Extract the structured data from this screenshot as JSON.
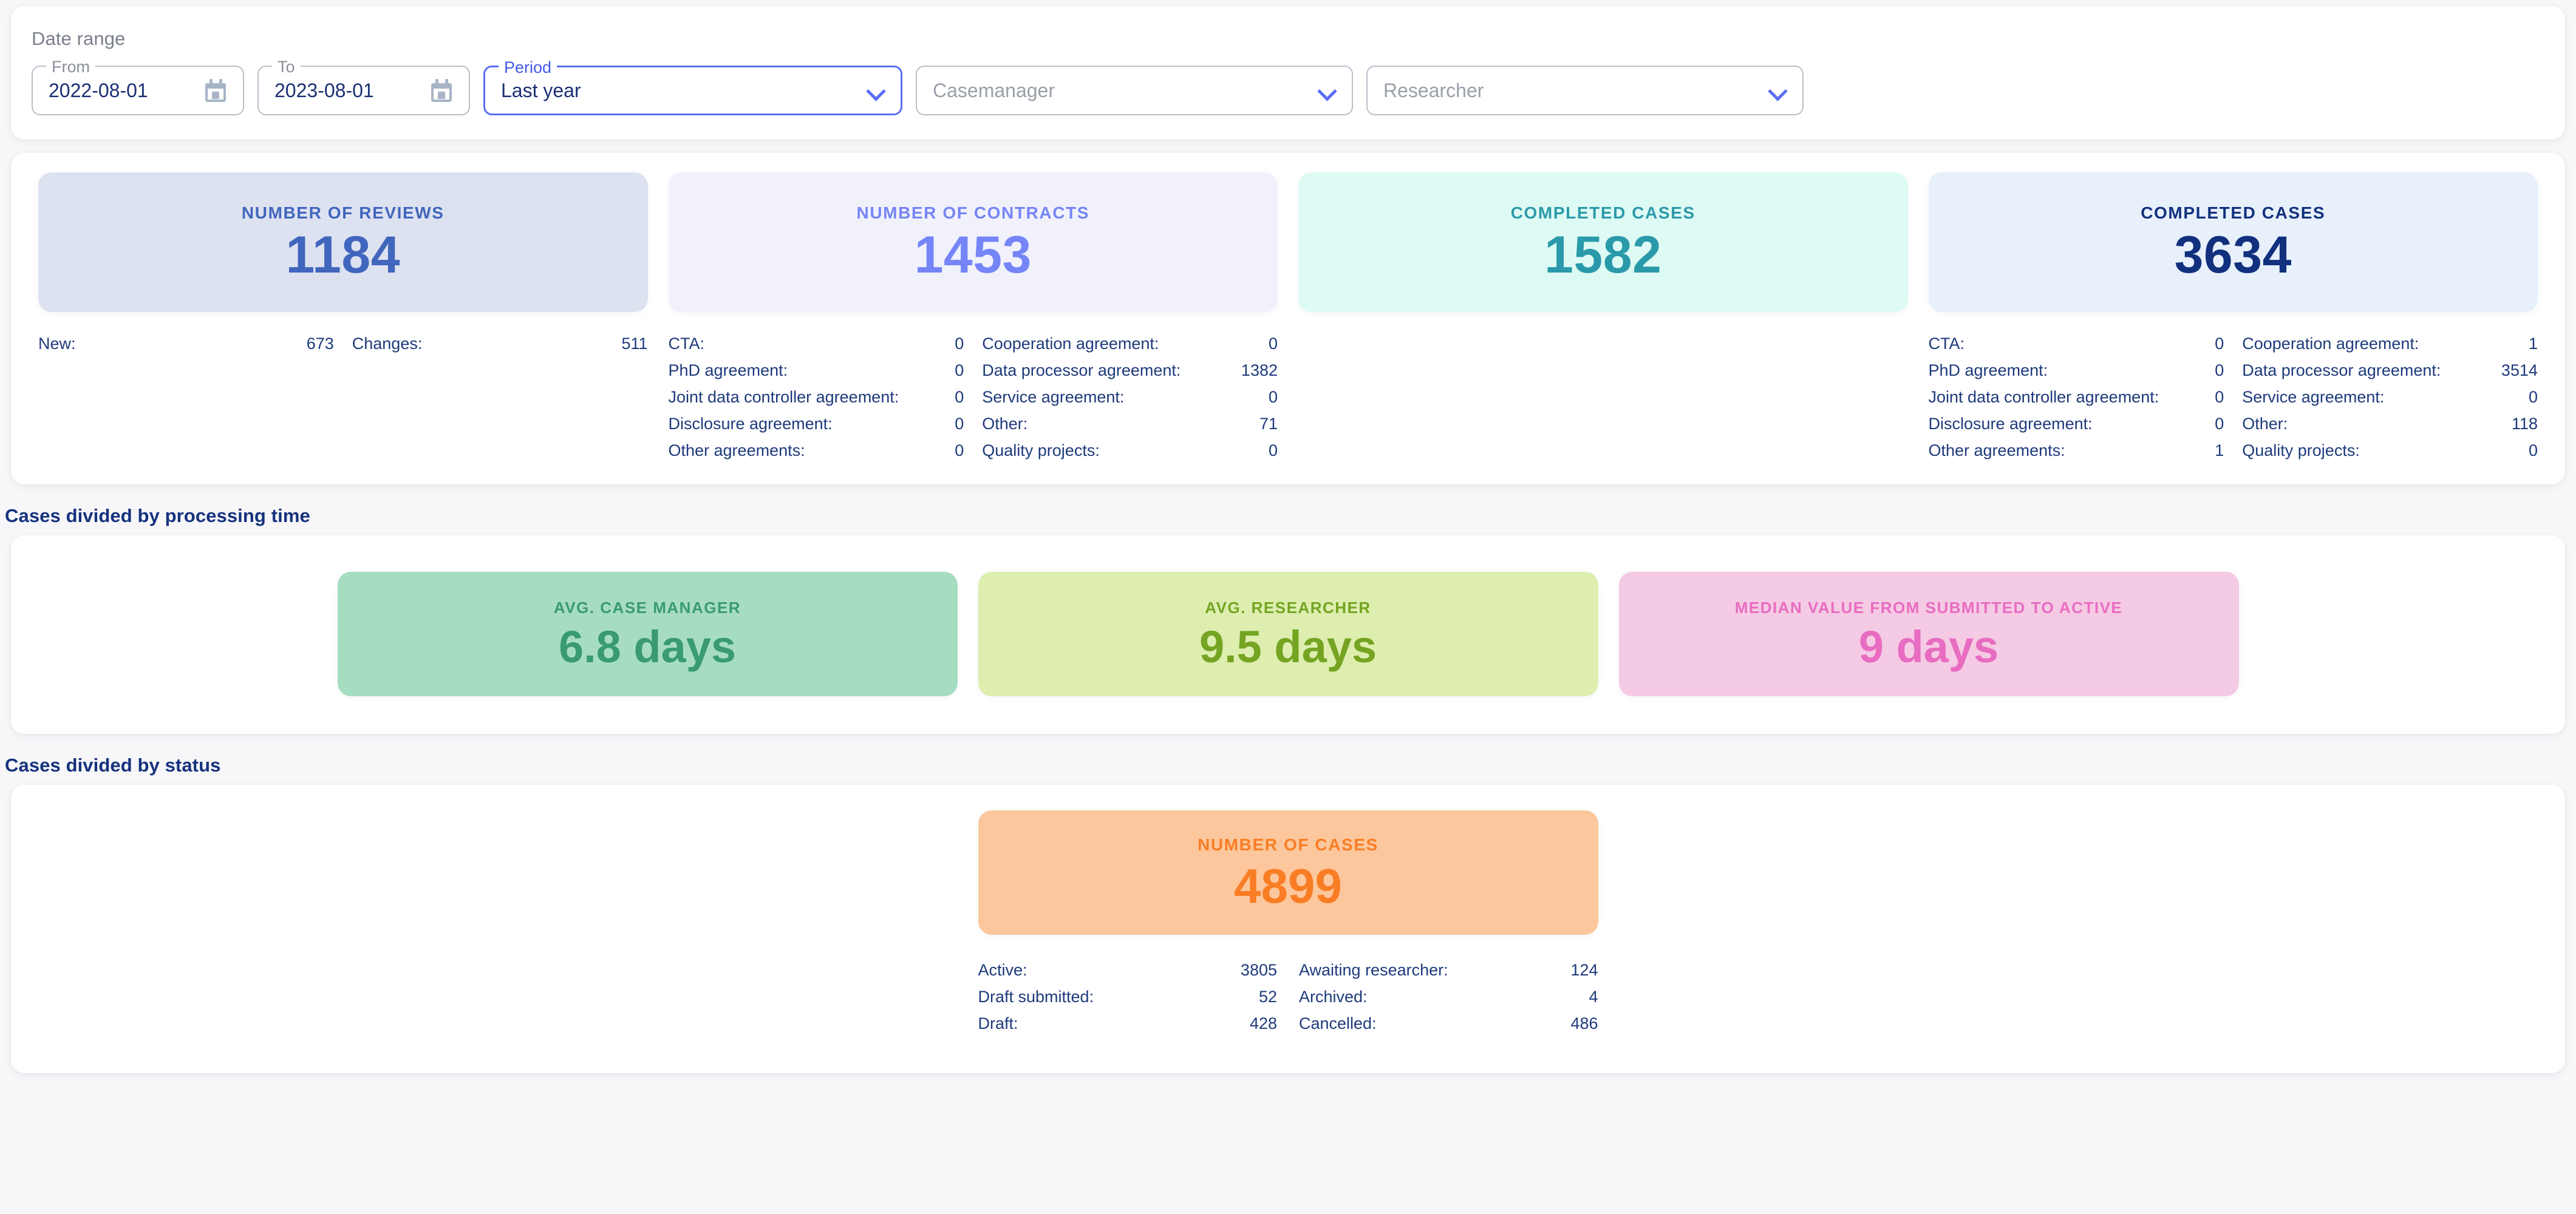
{
  "filters": {
    "legend": "Date range",
    "from": {
      "label": "From",
      "value": "2022-08-01",
      "icon": "calendar-icon"
    },
    "to": {
      "label": "To",
      "value": "2023-08-01",
      "icon": "calendar-icon"
    },
    "period": {
      "label": "Period",
      "value": "Last year",
      "icon": "chevron-down-icon"
    },
    "casemanager": {
      "label": "",
      "placeholder": "Casemanager",
      "value": "",
      "icon": "chevron-down-icon"
    },
    "researcher": {
      "label": "",
      "placeholder": "Researcher",
      "value": "",
      "icon": "chevron-down-icon"
    }
  },
  "colors": {
    "reviews_bg": "#dde2f1",
    "reviews_fg": "#4166bd",
    "contracts_bg": "#f1f1fc",
    "contracts_fg": "#7585f7",
    "completed_teal_bg": "#defaf4",
    "completed_teal_fg": "#2a9aaa",
    "completed_navy_bg": "#e7f0fb",
    "completed_navy_fg": "#11307e",
    "case_manager_bg": "#a6ddc1",
    "case_manager_fg": "#3a9a71",
    "researcher_bg": "#ddeeae",
    "researcher_fg": "#74a422",
    "median_bg": "#f5cae4",
    "median_fg": "#e86cc1",
    "cases_bg": "#fcc79c",
    "cases_fg": "#f97d25",
    "detail_text": "#1e3a7b",
    "section_title": "#16327d",
    "accent": "#5b6ef5"
  },
  "kpis": [
    {
      "title": "Number of reviews",
      "value": "1184",
      "details_left": [
        {
          "label": "New:",
          "value": "673"
        }
      ],
      "details_right": [
        {
          "label": "Changes:",
          "value": "511"
        }
      ]
    },
    {
      "title": "Number of contracts",
      "value": "1453",
      "details_left": [
        {
          "label": "CTA:",
          "value": "0"
        },
        {
          "label": "PhD agreement:",
          "value": "0"
        },
        {
          "label": "Joint data controller agreement:",
          "value": "0"
        },
        {
          "label": "Disclosure agreement:",
          "value": "0"
        },
        {
          "label": "Other agreements:",
          "value": "0"
        }
      ],
      "details_right": [
        {
          "label": "Cooperation agreement:",
          "value": "0"
        },
        {
          "label": "Data processor agreement:",
          "value": "1382"
        },
        {
          "label": "Service agreement:",
          "value": "0"
        },
        {
          "label": "Other:",
          "value": "71"
        },
        {
          "label": "Quality projects:",
          "value": "0"
        }
      ]
    },
    {
      "title": "Completed cases",
      "value": "1582",
      "details_left": [],
      "details_right": []
    },
    {
      "title": "Completed cases",
      "value": "3634",
      "details_left": [
        {
          "label": "CTA:",
          "value": "0"
        },
        {
          "label": "PhD agreement:",
          "value": "0"
        },
        {
          "label": "Joint data controller agreement:",
          "value": "0"
        },
        {
          "label": "Disclosure agreement:",
          "value": "0"
        },
        {
          "label": "Other agreements:",
          "value": "1"
        }
      ],
      "details_right": [
        {
          "label": "Cooperation agreement:",
          "value": "1"
        },
        {
          "label": "Data processor agreement:",
          "value": "3514"
        },
        {
          "label": "Service agreement:",
          "value": "0"
        },
        {
          "label": "Other:",
          "value": "118"
        },
        {
          "label": "Quality projects:",
          "value": "0"
        }
      ]
    }
  ],
  "processing_time": {
    "section_title": "Cases divided by processing time",
    "cards": [
      {
        "title": "Avg. case manager",
        "value": "6.8 days"
      },
      {
        "title": "Avg. researcher",
        "value": "9.5 days"
      },
      {
        "title": "Median value from submitted to active",
        "value": "9 days"
      }
    ]
  },
  "status": {
    "section_title": "Cases divided by status",
    "card": {
      "title": "Number of cases",
      "value": "4899"
    },
    "details_left": [
      {
        "label": "Active:",
        "value": "3805"
      },
      {
        "label": "Draft submitted:",
        "value": "52"
      },
      {
        "label": "Draft:",
        "value": "428"
      }
    ],
    "details_right": [
      {
        "label": "Awaiting researcher:",
        "value": "124"
      },
      {
        "label": "Archived:",
        "value": "4"
      },
      {
        "label": "Cancelled:",
        "value": "486"
      }
    ]
  },
  "chart_data": {
    "type": "table",
    "title": "Case management dashboard KPIs",
    "series": [
      {
        "name": "Number of reviews",
        "value": 1184,
        "breakdown": {
          "New": 673,
          "Changes": 511
        }
      },
      {
        "name": "Number of contracts",
        "value": 1453,
        "breakdown": {
          "CTA": 0,
          "PhD agreement": 0,
          "Joint data controller agreement": 0,
          "Disclosure agreement": 0,
          "Other agreements": 0,
          "Cooperation agreement": 0,
          "Data processor agreement": 1382,
          "Service agreement": 0,
          "Other": 71,
          "Quality projects": 0
        }
      },
      {
        "name": "Completed cases (teal)",
        "value": 1582,
        "breakdown": {}
      },
      {
        "name": "Completed cases (navy)",
        "value": 3634,
        "breakdown": {
          "CTA": 0,
          "PhD agreement": 0,
          "Joint data controller agreement": 0,
          "Disclosure agreement": 0,
          "Other agreements": 1,
          "Cooperation agreement": 1,
          "Data processor agreement": 3514,
          "Service agreement": 0,
          "Other": 118,
          "Quality projects": 0
        }
      },
      {
        "name": "Avg. case manager (days)",
        "value": 6.8
      },
      {
        "name": "Avg. researcher (days)",
        "value": 9.5
      },
      {
        "name": "Median value from submitted to active (days)",
        "value": 9
      },
      {
        "name": "Number of cases",
        "value": 4899,
        "breakdown": {
          "Active": 3805,
          "Draft submitted": 52,
          "Draft": 428,
          "Awaiting researcher": 124,
          "Archived": 4,
          "Cancelled": 486
        }
      }
    ]
  }
}
